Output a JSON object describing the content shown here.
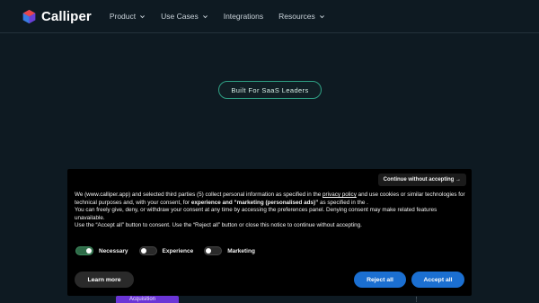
{
  "brand": {
    "name": "Calliper"
  },
  "nav": {
    "items": [
      {
        "label": "Product",
        "dropdown": true
      },
      {
        "label": "Use Cases",
        "dropdown": true
      },
      {
        "label": "Integrations",
        "dropdown": false
      },
      {
        "label": "Resources",
        "dropdown": true
      }
    ]
  },
  "hero": {
    "badge": "Built For SaaS Leaders"
  },
  "behind": {
    "tab_label": "Acquisition",
    "menu_glyph": "⋮"
  },
  "consent": {
    "continue_without": "Continue without accepting →",
    "p1_a": "We (www.calliper.app) and selected third parties (5) collect personal information as specified in the ",
    "p1_link": "privacy policy",
    "p1_b": " and use cookies or similar technologies for technical purposes and, with your consent, for ",
    "p1_bold": "experience and “marketing (personalised ads)”",
    "p1_c": " as specified in the .",
    "p2": "You can freely give, deny, or withdraw your consent at any time by accessing the preferences panel. Denying consent may make related features unavailable.",
    "p3": "Use the “Accept all” button to consent. Use the “Reject all” button or close this notice to continue without accepting.",
    "toggles": [
      {
        "label": "Necessary",
        "on": true
      },
      {
        "label": "Experience",
        "on": false
      },
      {
        "label": "Marketing",
        "on": false
      }
    ],
    "learn_more": "Learn more",
    "reject_all": "Reject all",
    "accept_all": "Accept all"
  },
  "colors": {
    "background": "#0e1a22",
    "badge_border": "#2fa084",
    "button_blue": "#1b6fd1",
    "toggle_on": "#2e6b48"
  }
}
